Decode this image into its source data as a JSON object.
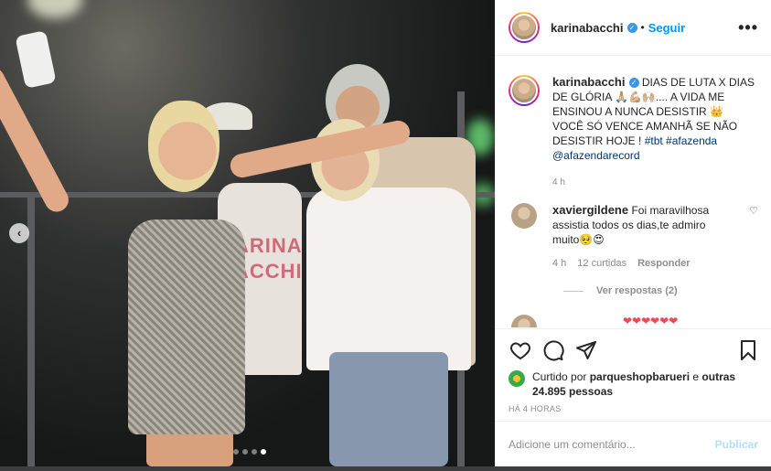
{
  "photo": {
    "alt_shirt_text": "ARINA\nACCHI",
    "carousel": {
      "count": 4,
      "active_index": 3
    },
    "prev_icon": "chevron-left-icon"
  },
  "post": {
    "username": "karinabacchi",
    "follow_label": "Seguir",
    "separator": "•",
    "more_label": "•••"
  },
  "caption": {
    "username": "karinabacchi",
    "text": "DIAS DE LUTA X DIAS DE GLÓRIA 🙏🏼💪🏼🙌🏼.... A VIDA ME ENSINOU A NUNCA DESISTIR 👑 VOCÊ SÓ VENCE AMANHÃ SE NÃO DESISTIR HOJE ! ",
    "hashtags": "#tbt #afazenda @afazendarecord",
    "time": "4 h"
  },
  "comments": [
    {
      "username": "xaviergildene",
      "text": "Foi maravilhosa assistia todos os dias,te admiro muito🥺😍",
      "time": "4 h",
      "likes": "12 curtidas",
      "reply_label": "Responder",
      "view_replies": "Ver respostas (2)"
    }
  ],
  "next_comment": {
    "hearts": "❤❤❤❤❤❤"
  },
  "actions": {
    "like_icon": "heart-icon",
    "comment_icon": "comment-icon",
    "share_icon": "share-icon",
    "save_icon": "bookmark-icon"
  },
  "likes": {
    "prefix": "Curtido por ",
    "user": "parqueshopbarueri",
    "middle": " e ",
    "others": "outras 24.895 pessoas"
  },
  "posted_ago": "HÁ 4 HORAS",
  "add_comment": {
    "placeholder": "Adicione um comentário...",
    "publish_label": "Publicar"
  },
  "colors": {
    "link_blue": "#0095f6",
    "publish_disabled": "#b2dffc",
    "hashtag": "#00376b",
    "muted": "#8e8e8e"
  }
}
